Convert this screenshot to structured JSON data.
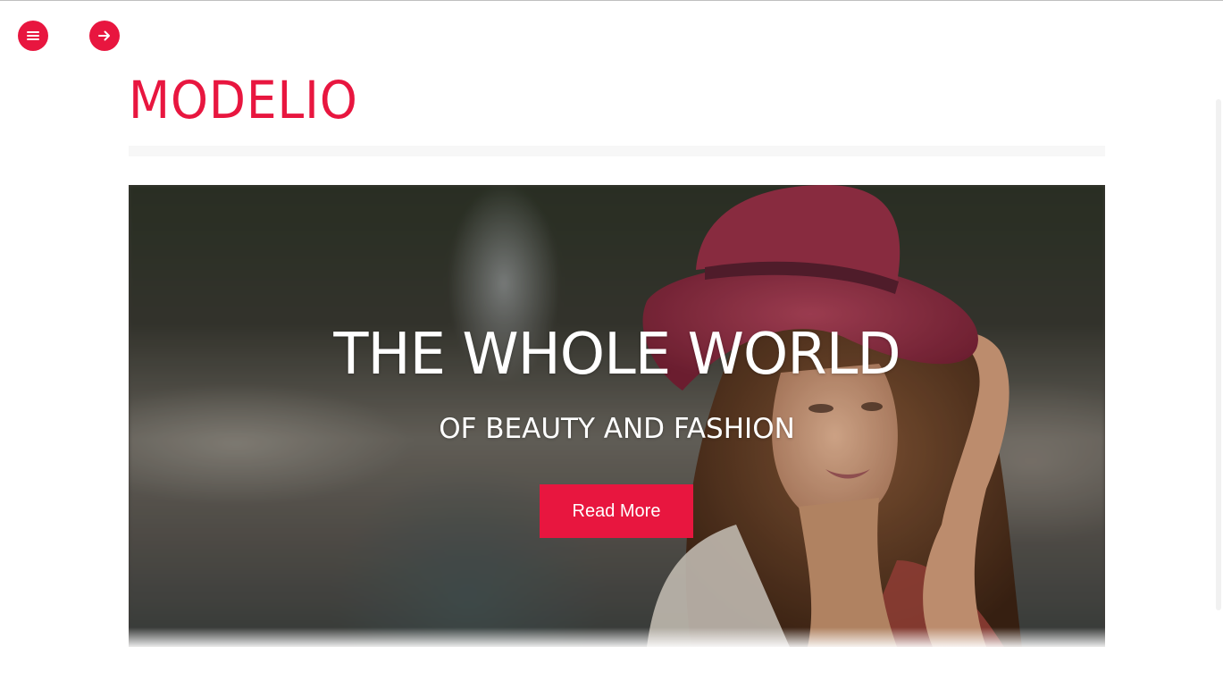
{
  "header": {
    "menu_icon": "hamburger-menu-icon",
    "next_icon": "arrow-right-icon",
    "brand": "MODELIO"
  },
  "hero": {
    "title": "THE WHOLE WORLD",
    "subtitle": "OF BEAUTY AND FASHION",
    "button_label": "Read More"
  },
  "colors": {
    "accent": "#e8163f",
    "text_on_image": "#ffffff",
    "background": "#ffffff"
  }
}
